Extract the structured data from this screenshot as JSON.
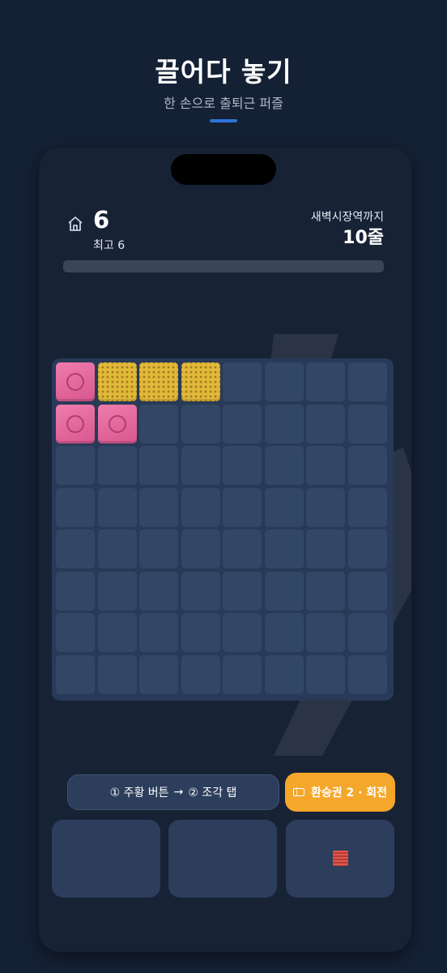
{
  "header": {
    "title": "끌어다 놓기",
    "subtitle": "한 손으로 출퇴근 퍼즐",
    "accent_color": "#2f73d9"
  },
  "status": {
    "score": "6",
    "best_label": "최고",
    "best_value": "6",
    "destination": "새벽시장역까지",
    "lines_remaining": "10줄",
    "progress_fraction": 0
  },
  "board": {
    "size": 8,
    "filled": [
      {
        "row": 0,
        "col": 0,
        "piece": "pink"
      },
      {
        "row": 0,
        "col": 1,
        "piece": "yellow"
      },
      {
        "row": 0,
        "col": 2,
        "piece": "yellow"
      },
      {
        "row": 0,
        "col": 3,
        "piece": "yellow"
      },
      {
        "row": 1,
        "col": 0,
        "piece": "pink"
      },
      {
        "row": 1,
        "col": 1,
        "piece": "pink"
      }
    ],
    "colors": {
      "empty": "#324766",
      "pink": "#e86a9e",
      "yellow": "#e1b93a"
    }
  },
  "controls": {
    "hint_step1": "① 주황 버튼",
    "hint_arrow": "→",
    "hint_step2": "② 조각 탭",
    "ticket_label": "환승권 2 · 회전",
    "ticket_color": "#f4a72a"
  },
  "tray": {
    "slots": [
      {
        "piece": "empty"
      },
      {
        "piece": "empty"
      },
      {
        "piece": "red-single"
      }
    ]
  }
}
